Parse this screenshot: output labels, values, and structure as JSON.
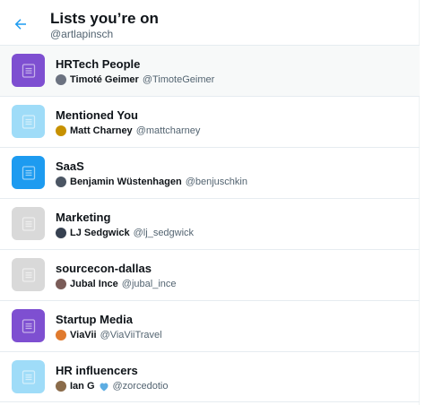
{
  "header": {
    "title": "Lists you’re on",
    "handle": "@artlapinsch"
  },
  "colors": {
    "accent": "#1d9bf0"
  },
  "lists": [
    {
      "name": "HRTech People",
      "owner_name": "Timoté Geimer",
      "owner_handle": "@TimoteGeimer",
      "icon_color": "#7e4fd1",
      "avatar_color": "#6b7280"
    },
    {
      "name": "Mentioned You",
      "owner_name": "Matt Charney",
      "owner_handle": "@mattcharney",
      "icon_color": "#9fdcf8",
      "avatar_color": "#c79100"
    },
    {
      "name": "SaaS",
      "owner_name": "Benjamin Wüstenhagen",
      "owner_handle": "@benjuschkin",
      "icon_color": "#1d9bf0",
      "avatar_color": "#4b5563"
    },
    {
      "name": "Marketing",
      "owner_name": "LJ Sedgwick",
      "owner_handle": "@lj_sedgwick",
      "icon_color": "#d9d9d9",
      "avatar_color": "#374151"
    },
    {
      "name": "sourcecon-dallas",
      "owner_name": "Jubal Ince",
      "owner_handle": "@jubal_ince",
      "icon_color": "#d9d9d9",
      "avatar_color": "#7a5c58"
    },
    {
      "name": "Startup Media",
      "owner_name": "ViaVii",
      "owner_handle": "@ViaViiTravel",
      "icon_color": "#7e4fd1",
      "avatar_color": "#e07a2e"
    },
    {
      "name": "HR influencers",
      "owner_name": "Ian G",
      "owner_handle": "@zorcedotio",
      "icon_color": "#9fdcf8",
      "avatar_color": "#8a6b4a",
      "emoji": "blue-heart-icon"
    }
  ]
}
